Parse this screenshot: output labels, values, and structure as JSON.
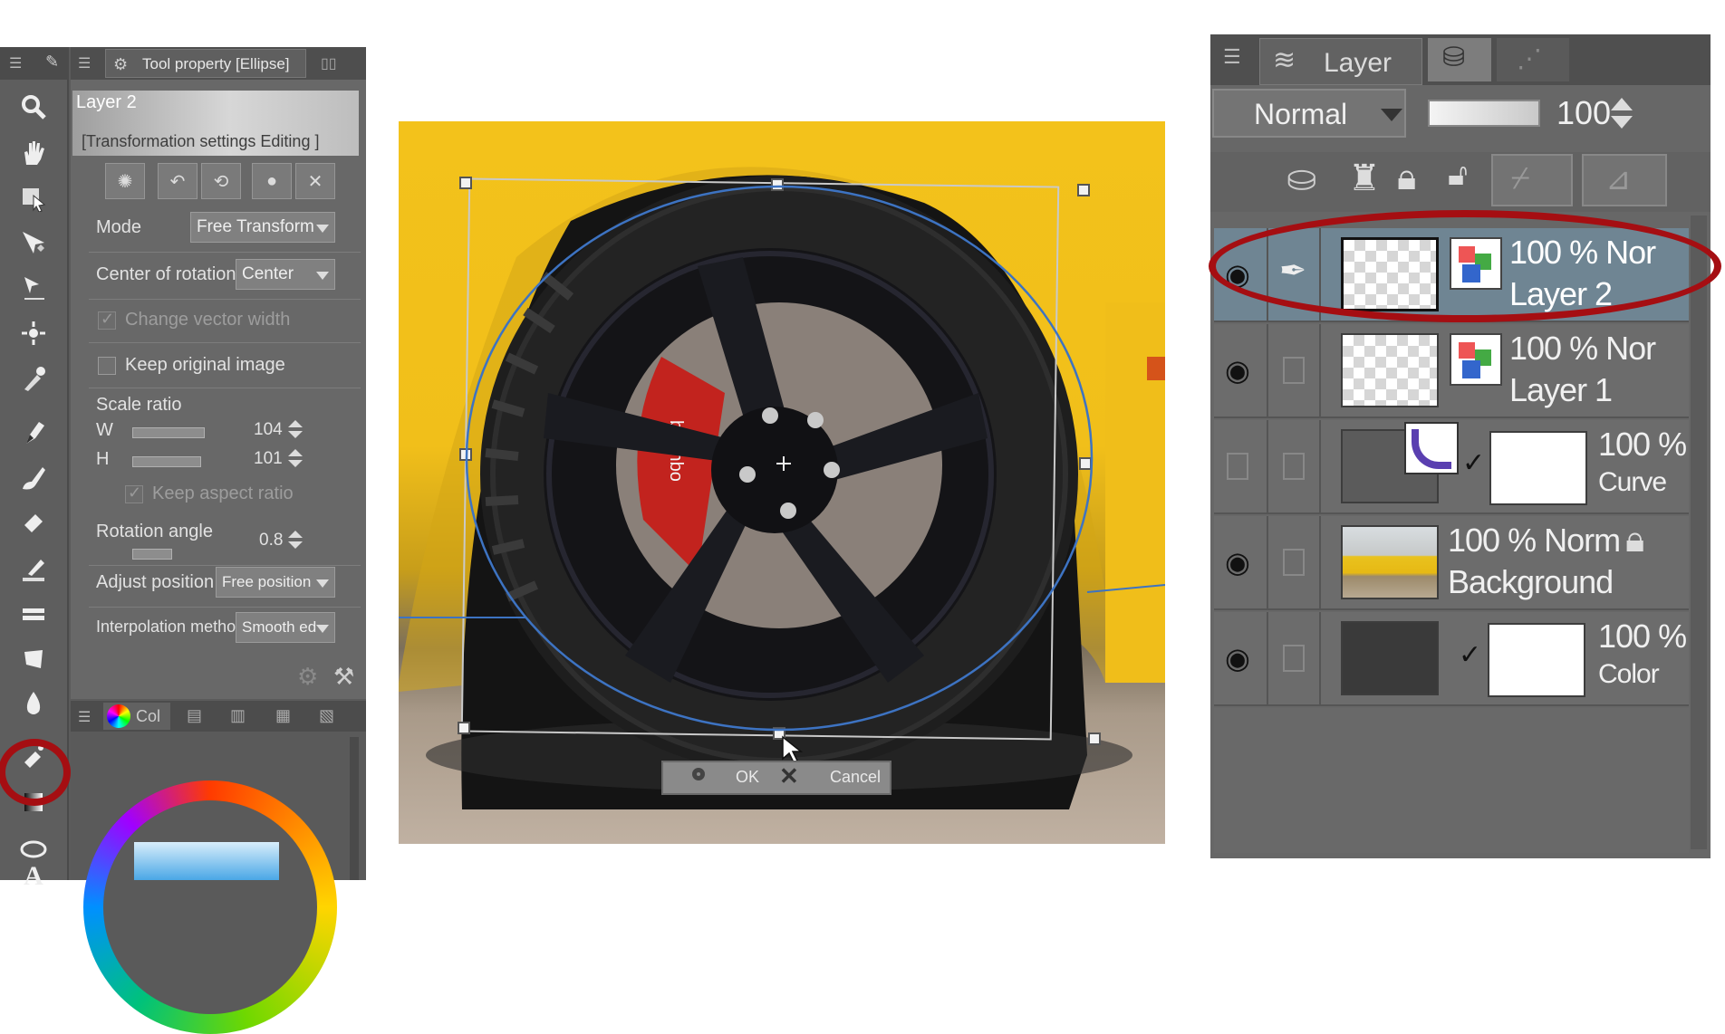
{
  "tool_property": {
    "title": "Tool property [Ellipse]",
    "layer_name": "Layer 2",
    "transform_label": "[Transformation settings Editing ]",
    "mode_label": "Mode",
    "mode_value": "Free Transform",
    "center_label": "Center of rotation",
    "center_value": "Center",
    "change_vector_label": "Change vector width",
    "keep_original_label": "Keep original image",
    "scale_label": "Scale ratio",
    "w_label": "W",
    "w_value": "104",
    "h_label": "H",
    "h_value": "101",
    "keep_aspect_label": "Keep aspect ratio",
    "rotation_label": "Rotation angle",
    "rotation_value": "0.8",
    "adjust_label": "Adjust position",
    "adjust_value": "Free position",
    "interp_label": "Interpolation method",
    "interp_value": "Smooth ed"
  },
  "color_panel": {
    "tab_label": "Col"
  },
  "canvas": {
    "ok_label": "OK",
    "cancel_label": "Cancel",
    "brand_text": "brembo"
  },
  "layer_panel": {
    "tab_label": "Layer",
    "blend_mode": "Normal",
    "opacity": "100",
    "layers": [
      {
        "line1": "100 % Nor",
        "line2": "Layer 2",
        "selected": true
      },
      {
        "line1": "100 % Nor",
        "line2": "Layer 1"
      },
      {
        "line1": "100 %",
        "line2": "Curve"
      },
      {
        "line1": "100 % Norm",
        "line2": "Background"
      },
      {
        "line1": "100 %",
        "line2": "Color"
      }
    ]
  },
  "colors": {
    "annotation_red": "#a50e12",
    "car_yellow": "#f3c21b",
    "selection_blue": "#6f8593"
  }
}
